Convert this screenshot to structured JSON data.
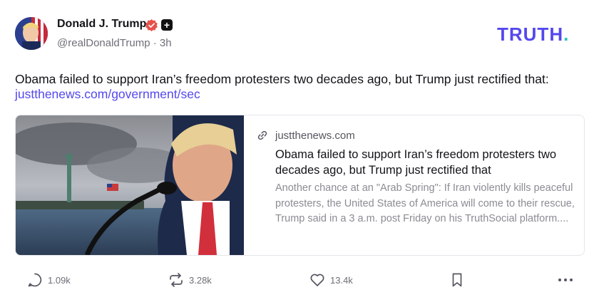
{
  "author": {
    "name": "Donald J. Trump",
    "handle": "@realDonaldTrump",
    "time": "3h",
    "handle_line": "@realDonaldTrump · 3h"
  },
  "brand": {
    "logo_text": "TRUTH",
    "logo_dot": ".",
    "accent": "#5448ee",
    "dot_color": "#1fc7c0"
  },
  "post": {
    "text": "Obama failed to support Iran’s freedom protesters two decades ago, but Trump just rectified that:",
    "link_text": "justthenews.com/government/sec"
  },
  "card": {
    "domain": "justthenews.com",
    "title": "Obama failed to support Iran’s freedom protesters two decades ago, but Trump just rectified that",
    "description": "Another chance at an \"Arab Spring\": If Iran violently kills peaceful protesters, the United States of America will come to their rescue, Trump said in a 3 a.m. post Friday on his TruthSocial platform...."
  },
  "actions": {
    "replies": "1.09k",
    "retruths": "3.28k",
    "likes": "13.4k"
  },
  "icons": {
    "reply": "reply-icon",
    "retruth": "retruth-icon",
    "like": "heart-icon",
    "bookmark": "bookmark-icon",
    "more": "more-icon",
    "verified": "verified-badge-icon",
    "link": "link-icon"
  }
}
